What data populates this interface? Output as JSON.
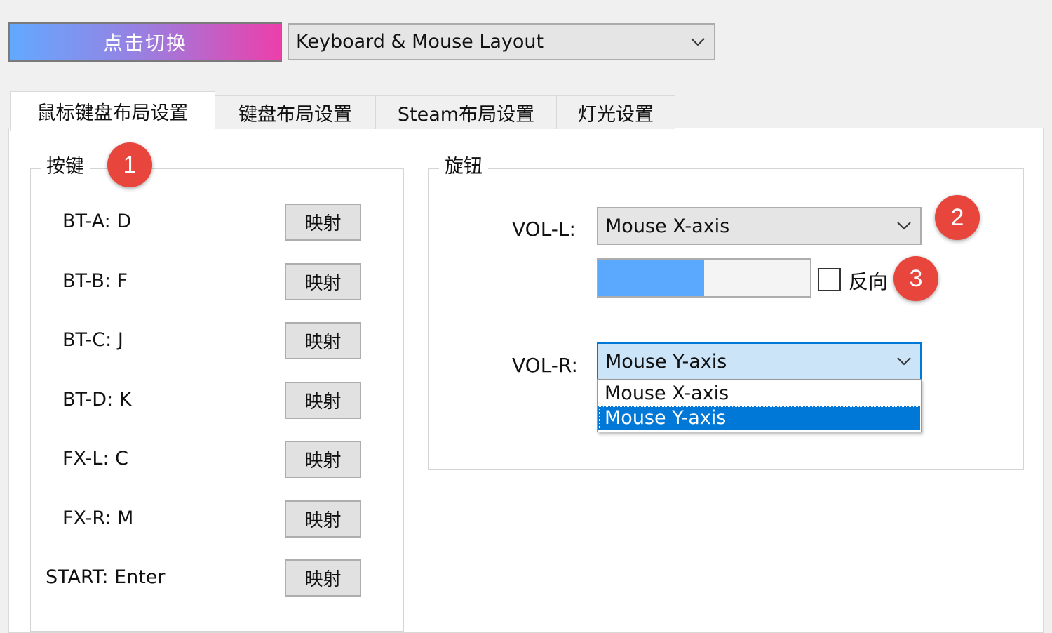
{
  "top_bar": {
    "switch_button": "点击切换",
    "layout_select": "Keyboard & Mouse Layout"
  },
  "tabs": [
    {
      "label": "鼠标键盘布局设置",
      "active": true
    },
    {
      "label": "键盘布局设置",
      "active": false
    },
    {
      "label": "Steam布局设置",
      "active": false
    },
    {
      "label": "灯光设置",
      "active": false
    }
  ],
  "buttons_group": {
    "title": "按键",
    "badge": "1",
    "map_label": "映射",
    "keys": [
      {
        "label": "BT-A:",
        "value": "D"
      },
      {
        "label": "BT-B:",
        "value": "F"
      },
      {
        "label": "BT-C:",
        "value": "J"
      },
      {
        "label": "BT-D:",
        "value": "K"
      },
      {
        "label": "FX-L:",
        "value": "C"
      },
      {
        "label": "FX-R:",
        "value": "M"
      },
      {
        "label": "START:",
        "value": "Enter"
      }
    ]
  },
  "knob_group": {
    "title": "旋钮",
    "vol_l_label": "VOL-L:",
    "vol_l_value": "Mouse X-axis",
    "vol_l_badge": "2",
    "progress_fraction": 0.5,
    "reverse_label": "反向",
    "reverse_checked": false,
    "reverse_badge": "3",
    "vol_r_label": "VOL-R:",
    "vol_r_value": "Mouse Y-axis",
    "dropdown_options": [
      "Mouse X-axis",
      "Mouse Y-axis"
    ],
    "dropdown_selected": "Mouse Y-axis"
  },
  "colors": {
    "badge": "#e8453c",
    "selection": "#0078d7",
    "progress_fill": "#5aa9ff",
    "active_select_bg": "#cce4f7",
    "active_select_border": "#0078d7"
  }
}
